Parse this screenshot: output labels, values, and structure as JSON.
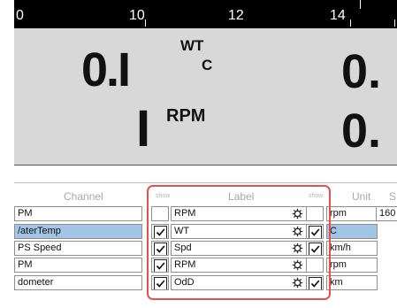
{
  "ruler": {
    "ticks": [
      "0",
      "10",
      "12",
      "14"
    ]
  },
  "gauges": [
    {
      "value": "0.I",
      "unit_top": "WT",
      "unit_bottom": "C"
    },
    {
      "value": "I",
      "unit_top": "RPM",
      "unit_bottom": ""
    }
  ],
  "right_gauge_values": [
    "0.",
    "0."
  ],
  "table": {
    "headers": {
      "channel": "Channel",
      "show": "show",
      "label": "Label",
      "show2": "show",
      "unit": "Unit",
      "extra": "S"
    },
    "rows": [
      {
        "channel": "PM",
        "show": false,
        "label": "RPM",
        "show2": false,
        "unit": "rpm",
        "extra": "160",
        "selected": false
      },
      {
        "channel": "/aterTemp",
        "show": true,
        "label": "WT",
        "show2": true,
        "unit": "C",
        "extra": "",
        "selected": true
      },
      {
        "channel": "PS Speed",
        "show": true,
        "label": "Spd",
        "show2": true,
        "unit": "km/h",
        "extra": "",
        "selected": false
      },
      {
        "channel": "PM",
        "show": true,
        "label": "RPM",
        "show2": false,
        "unit": "rpm",
        "extra": "",
        "selected": false
      },
      {
        "channel": "dometer",
        "show": true,
        "label": "OdD",
        "show2": true,
        "unit": "km",
        "extra": "",
        "selected": false
      }
    ]
  },
  "colors": {
    "selection": "#a2c4e6",
    "highlight_box": "#e0524a"
  }
}
